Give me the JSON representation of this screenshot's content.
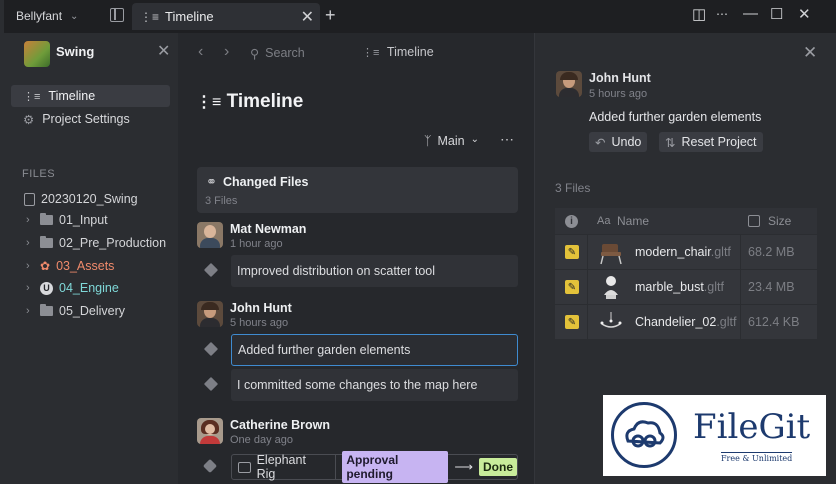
{
  "titlebar": {
    "workspace": "Bellyfant",
    "tab_label": "Timeline"
  },
  "sidebar": {
    "project_name": "Swing",
    "nav": [
      {
        "label": "Timeline",
        "active": true
      },
      {
        "label": "Project Settings",
        "active": false
      }
    ],
    "files_header": "FILES",
    "root_folder": "20230120_Swing",
    "tree": [
      {
        "label": "01_Input",
        "color": "#d4d5d8"
      },
      {
        "label": "02_Pre_Production",
        "color": "#d4d5d8"
      },
      {
        "label": "03_Assets",
        "color": "#f08a6b"
      },
      {
        "label": "04_Engine",
        "color": "#7fd8d8"
      },
      {
        "label": "05_Delivery",
        "color": "#d4d5d8"
      }
    ]
  },
  "center": {
    "search_placeholder": "Search",
    "breadcrumb": "Timeline",
    "page_title": "Timeline",
    "branch": "Main",
    "changed_files": {
      "title": "Changed Files",
      "count": "3 Files"
    },
    "entries": [
      {
        "author": "Mat Newman",
        "when": "1 hour ago",
        "commits": [
          "Improved distribution on scatter tool"
        ]
      },
      {
        "author": "John Hunt",
        "when": "5 hours ago",
        "commits": [
          "Added further garden elements",
          "I committed some changes to the map here"
        ]
      },
      {
        "author": "Catherine Brown",
        "when": "One day ago",
        "rig": {
          "label": "Elephant Rig",
          "from": "Approval pending",
          "to": "Done"
        }
      }
    ]
  },
  "detail": {
    "author": "John Hunt",
    "when": "5 hours ago",
    "message": "Added further garden elements",
    "undo_label": "Undo",
    "reset_label": "Reset Project",
    "file_count": "3 Files",
    "columns": {
      "name": "Name",
      "size": "Size"
    },
    "files": [
      {
        "name": "modern_chair",
        "ext": ".gltf",
        "size": "68.2 MB",
        "icon": "chair-thumbnail"
      },
      {
        "name": "marble_bust",
        "ext": ".gltf",
        "size": "23.4 MB",
        "icon": "bust-thumbnail"
      },
      {
        "name": "Chandelier_02",
        "ext": ".gltf",
        "size": "612.4 KB",
        "icon": "chandelier-thumbnail"
      }
    ]
  },
  "watermark": {
    "title": "FileGit",
    "subtitle": "Free & Unlimited"
  },
  "colors": {
    "accent": "#3f8bd0",
    "approval_pending": "#c7b4f2",
    "done": "#c8ec9a",
    "pencil": "#e3c23a"
  }
}
